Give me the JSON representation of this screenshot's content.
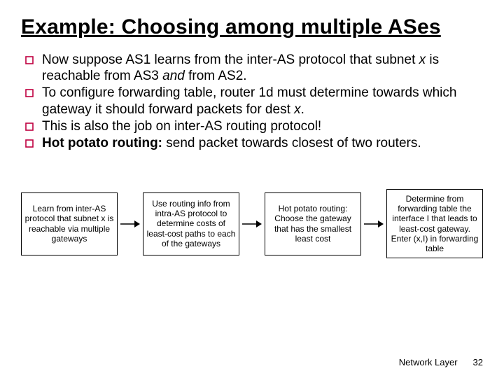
{
  "title": "Example: Choosing among multiple ASes",
  "bullets": [
    {
      "pre": "Now suppose AS1 learns from the inter-AS protocol that subnet ",
      "mid": "x",
      "post": " is reachable from AS3 ",
      "post2": "and",
      "post3": " from AS2."
    },
    {
      "pre": "To configure forwarding table, router 1d must determine towards which gateway it should forward packets for dest ",
      "mid": "x",
      "post": "",
      "post2": "",
      "post3": "."
    },
    {
      "pre": "This is also the job on inter-AS routing protocol!",
      "mid": "",
      "post": "",
      "post2": "",
      "post3": ""
    },
    {
      "pre": "",
      "hp": "Hot potato routing:",
      "post": " send packet towards closest of two routers."
    }
  ],
  "boxes": [
    "Learn from inter-AS protocol that subnet x is reachable via multiple gateways",
    "Use routing info from intra-AS protocol to determine costs of least-cost paths to each of the gateways",
    "Hot potato routing: Choose the gateway that has the smallest least cost",
    "Determine from forwarding table the interface I that leads to least-cost gateway. Enter (x,I) in forwarding table"
  ],
  "footer": {
    "label": "Network Layer",
    "page": "32"
  }
}
